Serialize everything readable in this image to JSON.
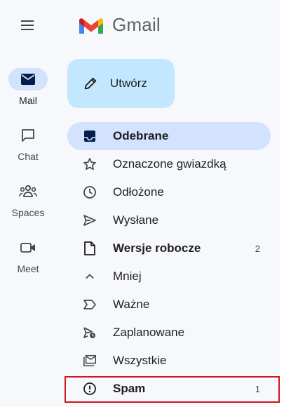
{
  "app": {
    "logo_text": "Gmail"
  },
  "rail": {
    "items": [
      {
        "label": "Mail",
        "icon": "mail-icon",
        "active": true
      },
      {
        "label": "Chat",
        "icon": "chat-icon",
        "active": false
      },
      {
        "label": "Spaces",
        "icon": "spaces-icon",
        "active": false
      },
      {
        "label": "Meet",
        "icon": "meet-icon",
        "active": false
      }
    ]
  },
  "compose": {
    "label": "Utwórz"
  },
  "nav": {
    "items": [
      {
        "label": "Odebrane",
        "icon": "inbox-icon",
        "count": ""
      },
      {
        "label": "Oznaczone gwiazdką",
        "icon": "star-icon",
        "count": ""
      },
      {
        "label": "Odłożone",
        "icon": "clock-icon",
        "count": ""
      },
      {
        "label": "Wysłane",
        "icon": "send-icon",
        "count": ""
      },
      {
        "label": "Wersje robocze",
        "icon": "draft-icon",
        "count": "2"
      },
      {
        "label": "Mniej",
        "icon": "chevron-up-icon",
        "count": ""
      },
      {
        "label": "Ważne",
        "icon": "important-icon",
        "count": ""
      },
      {
        "label": "Zaplanowane",
        "icon": "scheduled-send-icon",
        "count": ""
      },
      {
        "label": "Wszystkie",
        "icon": "all-mail-icon",
        "count": ""
      },
      {
        "label": "Spam",
        "icon": "spam-icon",
        "count": "1"
      }
    ]
  },
  "colors": {
    "active_bg": "#d3e3fd",
    "compose_bg": "#c2e7ff",
    "highlight": "#d4141b"
  }
}
